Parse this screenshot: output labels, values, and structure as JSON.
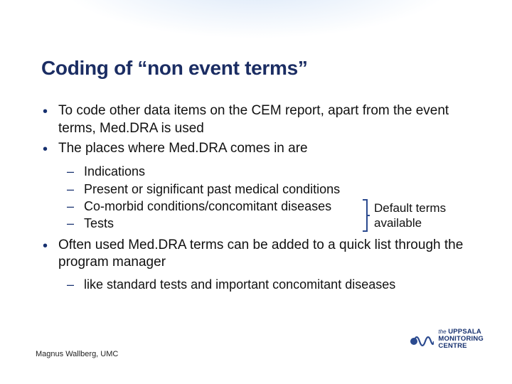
{
  "title": "Coding of “non event terms”",
  "bullets": {
    "b1": "To code other data items on the CEM report, apart from the event terms, Med.DRA is used",
    "b2": "The places where Med.DRA comes in are",
    "b2_sub": {
      "s1": "Indications",
      "s2": "Present or significant past medical conditions",
      "s3": "Co-morbid conditions/concomitant diseases",
      "s4": "Tests"
    },
    "bracket_note_line1": "Default terms",
    "bracket_note_line2": "available",
    "b3": "Often used Med.DRA terms can be added to a quick list through the program manager",
    "b3_sub": {
      "s1": "like standard tests and important concomitant diseases"
    }
  },
  "footer_author": "Magnus Wallberg, UMC",
  "logo": {
    "the": "the",
    "line1": "UPPSALA",
    "line2": "MONITORING",
    "line3": "CENTRE"
  }
}
